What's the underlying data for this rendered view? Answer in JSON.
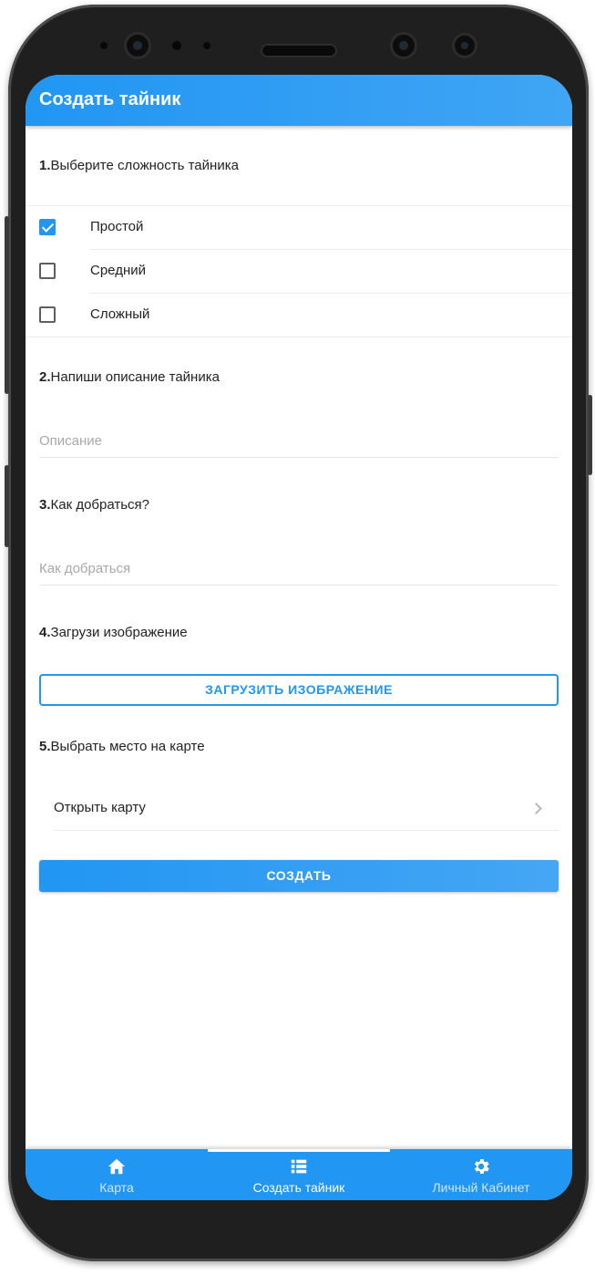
{
  "appbar": {
    "title": "Создать тайник"
  },
  "sections": {
    "difficulty": {
      "num": "1.",
      "text": "Выберите сложность тайника"
    },
    "description": {
      "num": "2.",
      "text": "Напиши описание тайника"
    },
    "directions": {
      "num": "3.",
      "text": "Как добраться?"
    },
    "image": {
      "num": "4.",
      "text": "Загрузи изображение"
    },
    "location": {
      "num": "5.",
      "text": "Выбрать место на карте"
    }
  },
  "difficulty_options": [
    {
      "label": "Простой",
      "checked": true
    },
    {
      "label": "Средний",
      "checked": false
    },
    {
      "label": "Сложный",
      "checked": false
    }
  ],
  "fields": {
    "description_placeholder": "Описание",
    "description_value": "",
    "directions_placeholder": "Как добраться",
    "directions_value": ""
  },
  "buttons": {
    "upload_image": "ЗАГРУЗИТЬ ИЗОБРАЖЕНИЕ",
    "open_map": "Открыть карту",
    "create": "СОЗДАТЬ"
  },
  "tabs": [
    {
      "label": "Карта",
      "icon": "home-icon",
      "active": false
    },
    {
      "label": "Создать тайник",
      "icon": "list-icon",
      "active": true
    },
    {
      "label": "Личный Кабинет",
      "icon": "gear-icon",
      "active": false
    }
  ],
  "colors": {
    "accent": "#2196f3",
    "tab_inactive_text": "#cfe6fb"
  }
}
